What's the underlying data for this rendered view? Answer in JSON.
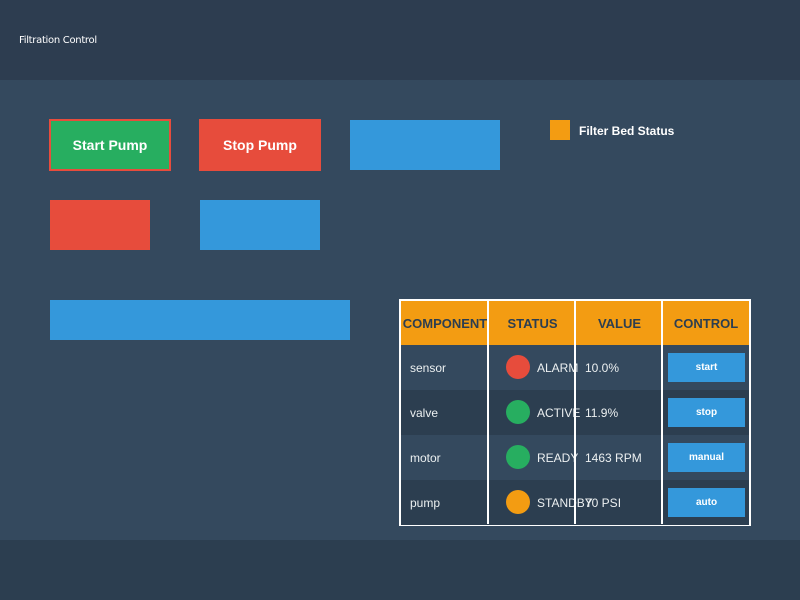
{
  "header": {
    "title": "Filtration Control"
  },
  "buttons": {
    "start_pump": "Start Pump",
    "stop_pump": "Stop Pump"
  },
  "legend": {
    "label": "Filter Bed Status",
    "color": "#f39c12"
  },
  "colors": {
    "green": "#27ae60",
    "red": "#e74c3c",
    "blue": "#3498db",
    "orange": "#f39c12",
    "header_bg": "#2d3d50",
    "panel_bg": "#34495e"
  },
  "table": {
    "headers": [
      "COMPONENT",
      "STATUS",
      "VALUE",
      "CONTROL"
    ],
    "rows": [
      {
        "component": "sensor",
        "status": "ALARM",
        "status_color": "#e74c3c",
        "value": "10.0%",
        "control": "start"
      },
      {
        "component": "valve",
        "status": "ACTIVE",
        "status_color": "#27ae60",
        "value": "11.9%",
        "control": "stop"
      },
      {
        "component": "motor",
        "status": "READY",
        "status_color": "#27ae60",
        "value": "1463 RPM",
        "control": "manual"
      },
      {
        "component": "pump",
        "status": "STANDBY",
        "status_color": "#f39c12",
        "value": "70 PSI",
        "control": "auto"
      }
    ]
  }
}
